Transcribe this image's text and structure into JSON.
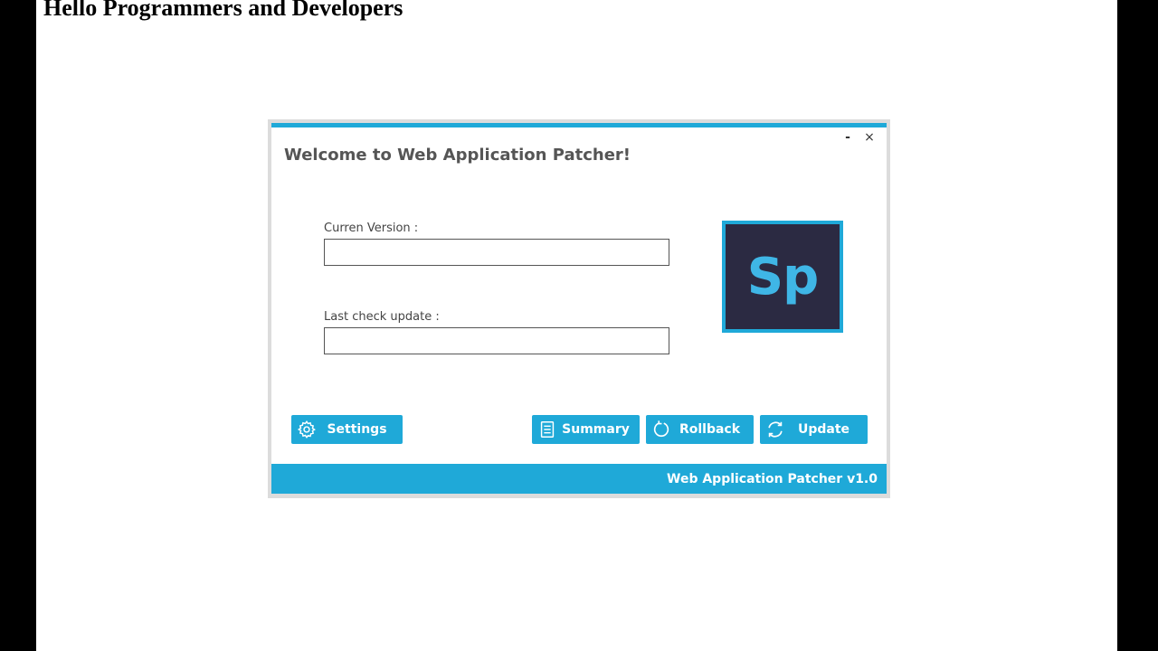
{
  "page": {
    "heading": "Hello Programmers and Developers"
  },
  "dialog": {
    "title": "Welcome to Web Application Patcher!",
    "minimize_label": "-",
    "close_label": "×",
    "fields": {
      "current_version": {
        "label": "Curren Version :",
        "value": ""
      },
      "last_check": {
        "label": "Last check update :",
        "value": ""
      }
    },
    "logo_text": "Sp",
    "buttons": {
      "settings": "Settings",
      "summary": "Summary",
      "rollback": "Rollback",
      "update": "Update"
    },
    "footer": "Web Application Patcher v1.0",
    "accent_color": "#1fa9d8",
    "logo_background": "#2b2a42"
  }
}
